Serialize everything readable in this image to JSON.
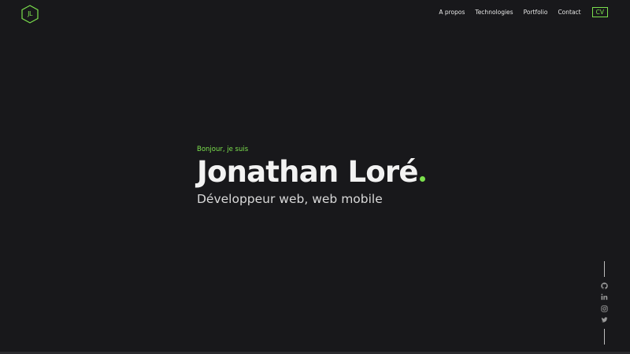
{
  "logo": {
    "text": "JL",
    "color": "#7be04d"
  },
  "nav": {
    "links": [
      "A propos",
      "Technologies",
      "Portfolio",
      "Contact"
    ],
    "cv_label": "CV"
  },
  "hero": {
    "greeting": "Bonjour, je suis",
    "name": "Jonathan Loré",
    "subtitle": "Développeur web, web mobile"
  },
  "social": {
    "icons": [
      "github-icon",
      "linkedin-icon",
      "instagram-icon",
      "twitter-icon"
    ]
  },
  "colors": {
    "background": "#18181b",
    "accent": "#7be04d",
    "text": "#f2f2f2"
  }
}
